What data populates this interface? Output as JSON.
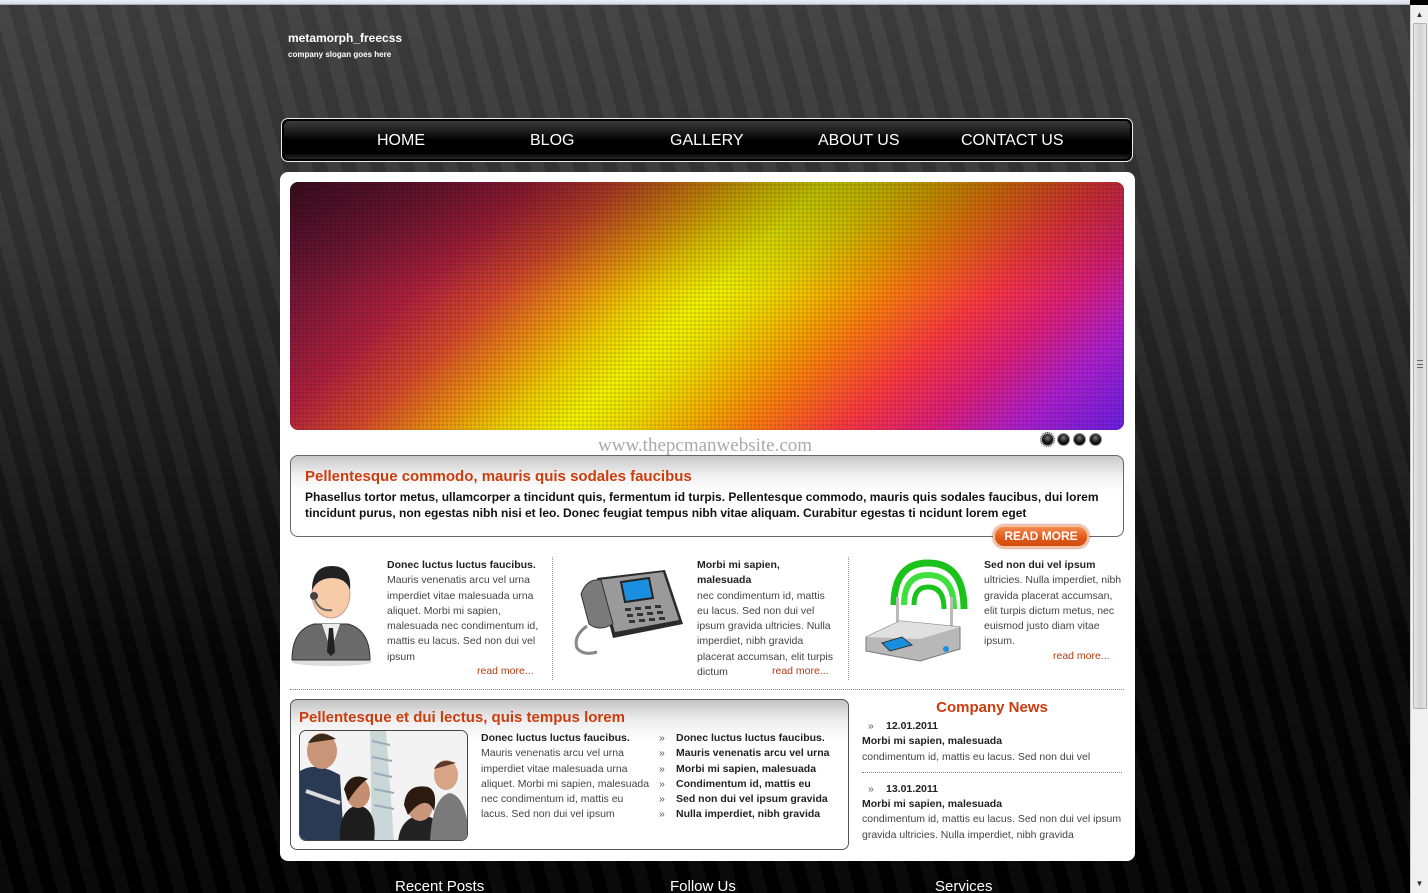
{
  "site": {
    "title": "metamorph_freecss",
    "slogan": "company slogan goes here"
  },
  "nav": {
    "items": [
      {
        "label": "HOME"
      },
      {
        "label": "BLOG"
      },
      {
        "label": "GALLERY"
      },
      {
        "label": "ABOUT US"
      },
      {
        "label": "CONTACT US"
      }
    ]
  },
  "banner": {
    "watermark": "www.thepcmanwebsite.com",
    "slide_count": 4,
    "active_slide": 1
  },
  "feature": {
    "title": "Pellentesque commodo, mauris quis sodales faucibus",
    "text": "Phasellus tortor metus, ullamcorper a tincidunt quis, fermentum id turpis. Pellentesque commodo, mauris quis sodales faucibus, dui lorem tincidunt purus, non egestas nibh nisi et leo. Donec feugiat tempus nibh vitae aliquam. Curabitur egestas ti ncidunt lorem eget",
    "button": "READ MORE"
  },
  "columns": [
    {
      "icon": "support-agent-icon",
      "heading": "Donec luctus luctus faucibus.",
      "text": "Mauris venenatis arcu vel urna imperdiet vitae malesuada urna aliquet. Morbi mi sapien, malesuada nec condimentum id, mattis eu lacus. Sed non dui vel ipsum",
      "more": "read more..."
    },
    {
      "icon": "desk-phone-icon",
      "heading": "Morbi mi sapien, malesuada",
      "text": "nec condimentum id, mattis eu lacus. Sed non dui vel ipsum gravida ultricies. Nulla imperdiet, nibh gravida placerat accumsan, elit turpis dictum",
      "more": "read more..."
    },
    {
      "icon": "wifi-router-icon",
      "heading": "Sed non dui vel ipsum",
      "text": "ultricies. Nulla imperdiet, nibh gravida placerat accumsan, elit turpis dictum metus, nec euismod justo diam vitae ipsum.",
      "more": "read more..."
    }
  ],
  "section2": {
    "title": "Pellentesque et dui lectus, quis tempus lorem",
    "heading": "Donec luctus luctus faucibus.",
    "text": "Mauris venenatis arcu vel urna imperdiet vitae malesuada urna aliquet. Morbi mi sapien, malesuada nec condimentum id, mattis eu lacus. Sed non dui vel ipsum",
    "list": [
      "Donec luctus luctus faucibus.",
      "Mauris venenatis arcu vel urna",
      "Morbi mi sapien, malesuada",
      "Condimentum id, mattis eu",
      "Sed non dui vel ipsum gravida",
      "Nulla imperdiet, nibh gravida"
    ],
    "bullet": "»"
  },
  "news": {
    "title": "Company News",
    "items": [
      {
        "date": "12.01.2011",
        "heading": "Morbi mi sapien, malesuada",
        "text": "condimentum id, mattis eu lacus. Sed non dui vel"
      },
      {
        "date": "13.01.2011",
        "heading": "Morbi mi sapien, malesuada",
        "text": "condimentum id, mattis eu lacus. Sed non dui vel ipsum gravida ultricies. Nulla imperdiet, nibh gravida"
      }
    ]
  },
  "footer": {
    "headings": [
      "Recent Posts",
      "Follow Us",
      "Services"
    ]
  },
  "colors": {
    "accent": "#cc3c0c",
    "button": "#e05818",
    "link": "#b23a10"
  }
}
